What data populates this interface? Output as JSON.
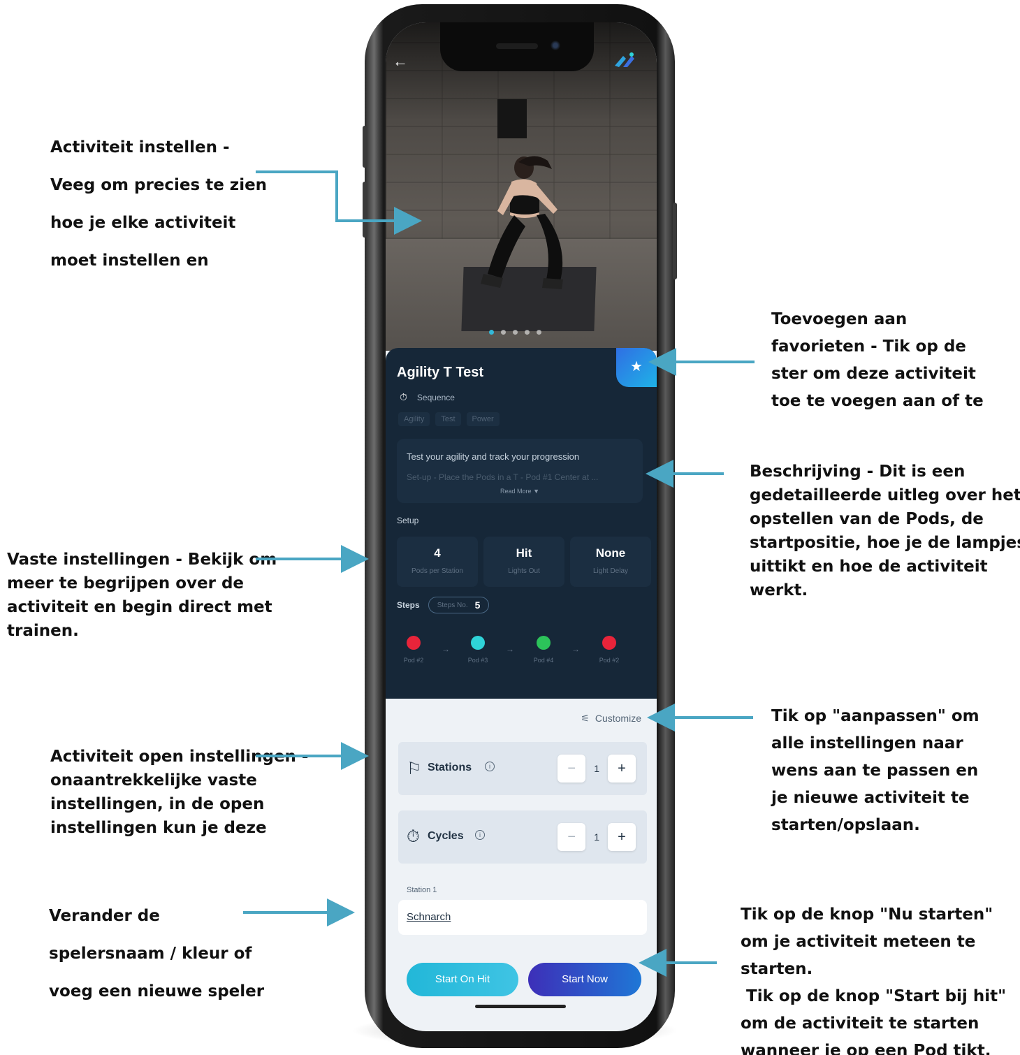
{
  "annotations": {
    "setup_video": [
      "Activiteit instellen -",
      "Veeg om precies te zien",
      "hoe je elke activiteit",
      "moet instellen en"
    ],
    "favorites": [
      "Toevoegen aan",
      "favorieten - Tik op de",
      "ster om deze activiteit",
      "toe te voegen aan of te"
    ],
    "description": [
      "Beschrijving - Dit is een",
      "gedetailleerde uitleg over het",
      "opstellen van de Pods, de",
      "startpositie, hoe je de lampjes",
      "uittikt en hoe de activiteit",
      "werkt."
    ],
    "fixed_settings": [
      "Vaste instellingen - Bekijk om",
      "meer te begrijpen over de",
      "activiteit en begin direct met",
      "trainen."
    ],
    "customize": [
      "Tik op \"aanpassen\" om",
      "alle instellingen naar",
      "wens aan te passen en",
      "je nieuwe activiteit te",
      "starten/opslaan."
    ],
    "open_settings": [
      "Activiteit open instellingen -",
      "onaantrekkelijke vaste",
      "instellingen, in de open",
      "instellingen kun je deze"
    ],
    "player": [
      "Verander de",
      "spelersnaam / kleur of",
      "voeg een nieuwe speler"
    ],
    "start_now": [
      "Tik op de knop \"Nu starten\"",
      "om je activiteit meteen te",
      "starten.",
      " Tik op de knop \"Start bij hit\"",
      "om de activiteit te starten",
      "wanneer je op een Pod tikt."
    ]
  },
  "app": {
    "back_icon": "arrow-left-icon",
    "logo_icon": "brand-logo-icon",
    "carousel": {
      "count": 5,
      "active": 1
    },
    "activity": {
      "title": "Agility T Test",
      "mode": "Sequence",
      "tags": [
        "Agility",
        "Test",
        "Power"
      ],
      "description": "Test your agility and track your progression",
      "description_more": "Set-up - Place the Pods in a T - Pod #1 Center at ...",
      "read_more": "Read More"
    },
    "setup": {
      "label": "Setup",
      "cards": [
        {
          "value": "4",
          "label": "Pods per Station"
        },
        {
          "value": "Hit",
          "label": "Lights Out"
        },
        {
          "value": "None",
          "label": "Light Delay"
        }
      ]
    },
    "steps": {
      "label": "Steps",
      "pill_label": "Steps No.",
      "count": "5",
      "pods": [
        {
          "label": "Pod #2",
          "color": "#e8243a"
        },
        {
          "label": "Pod #3",
          "color": "#2fd3d8"
        },
        {
          "label": "Pod #4",
          "color": "#2cc35a"
        },
        {
          "label": "Pod #2",
          "color": "#e8243a"
        }
      ]
    },
    "customize_label": "Customize",
    "options": [
      {
        "label": "Stations",
        "value": "1",
        "icon": "flag-icon"
      },
      {
        "label": "Cycles",
        "value": "1",
        "icon": "stopwatch-icon"
      }
    ],
    "player": {
      "station_label": "Station 1",
      "name": "Schnarch"
    },
    "buttons": {
      "start_on_hit": "Start On Hit",
      "start_now": "Start Now"
    },
    "colors": {
      "panel": "#162738",
      "accent": "#1fb2e6",
      "start_now": "#3d2fb8",
      "arrow": "#4aa6c3"
    }
  }
}
